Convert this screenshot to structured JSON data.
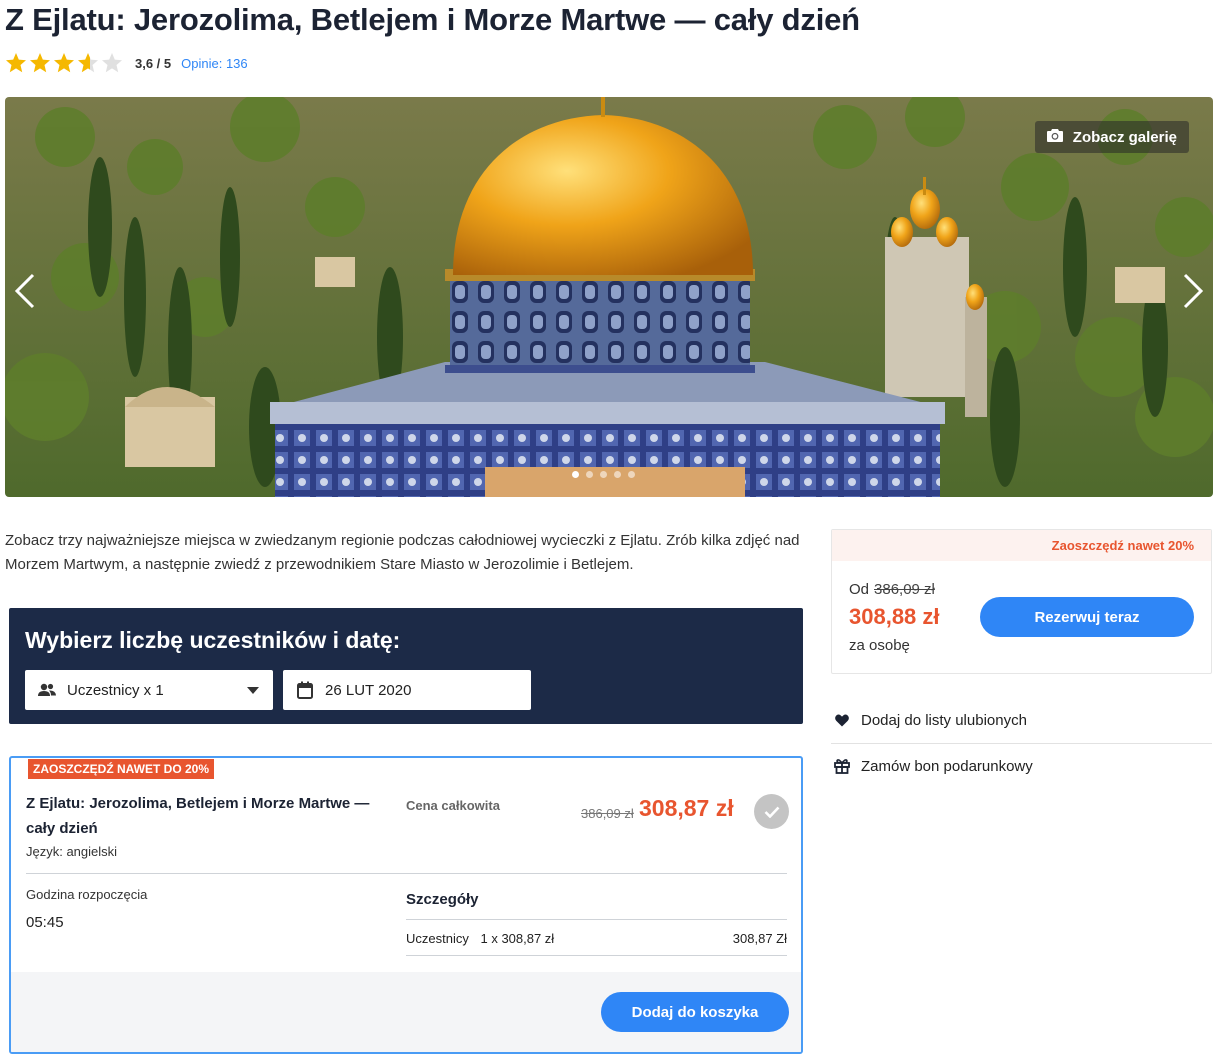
{
  "page": {
    "title": "Z Ejlatu: Jerozolima, Betlejem i Morze Martwe — cały dzień"
  },
  "rating": {
    "value": 3.6,
    "max": 5,
    "display": "3,6 / 5",
    "reviews_label": "Opinie: 136",
    "star_color": "#f5b800",
    "star_empty_color": "#e0e0e0"
  },
  "gallery": {
    "button_label": "Zobacz galerię",
    "dots_count": 5,
    "active_dot": 1
  },
  "intro_text": "Zobacz trzy najważniejsze miejsca w zwiedzanym regionie podczas całodniowej wycieczki z Ejlatu. Zrób kilka zdjęć nad Morzem Martwym, a następnie zwiedź z przewodnikiem Stare Miasto w Jerozolimie i Betlejem.",
  "picker": {
    "title": "Wybierz liczbę uczestników i datę:",
    "participants_value": "Uczestnicy x 1",
    "date_value": "26 LUT 2020"
  },
  "offer": {
    "badge": "ZAOSZCZĘDŹ NAWET DO 20%",
    "name": "Z Ejlatu: Jerozolima, Betlejem i Morze Martwe — cały dzień",
    "language": "Język: angielski",
    "total_label": "Cena całkowita",
    "old_price": "386,09 zł",
    "new_price": "308,87 zł",
    "start_label": "Godzina rozpoczęcia",
    "start_time": "05:45",
    "details_label": "Szczegóły",
    "participants_label": "Uczestnicy",
    "participants_qty": "1 x 308,87 zł",
    "participants_sum": "308,87 Zł",
    "add_to_cart": "Dodaj do koszyka"
  },
  "booking": {
    "save_label": "Zaoszczędź nawet 20%",
    "from_label": "Od",
    "old_price": "386,09 zł",
    "price": "308,88 zł",
    "per_person": "za osobę",
    "book_button": "Rezerwuj teraz"
  },
  "side_links": {
    "favorites": "Dodaj do listy ulubionych",
    "gift": "Zamów bon podarunkowy"
  },
  "colors": {
    "accent_blue": "#2f86f6",
    "sale_orange": "#e8552f",
    "navy": "#1c2a47"
  }
}
